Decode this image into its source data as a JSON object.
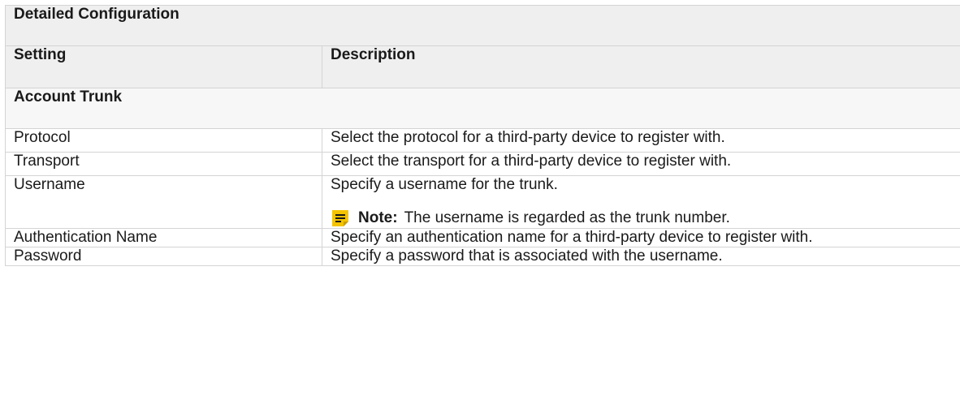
{
  "table": {
    "title": "Detailed Configuration",
    "headers": {
      "setting": "Setting",
      "description": "Description"
    },
    "section": "Account Trunk",
    "rows": [
      {
        "setting": "Protocol",
        "description": "Select the protocol for a third-party device to register with."
      },
      {
        "setting": "Transport",
        "description": "Select the transport for a third-party device to register with."
      },
      {
        "setting": "Username",
        "description": "Specify a username for the trunk.",
        "note_label": "Note:",
        "note_text": "The username is regarded as the trunk number."
      },
      {
        "setting": "Authentication Name",
        "description": "Specify an authentication name for a third-party device to register with."
      },
      {
        "setting": "Password",
        "description": "Specify a password that is associated with the username."
      }
    ]
  },
  "colors": {
    "note_icon": "#f5c400",
    "header_bg": "#efefef",
    "border": "#d4d4d4"
  },
  "icons": {
    "note": "note-icon"
  }
}
